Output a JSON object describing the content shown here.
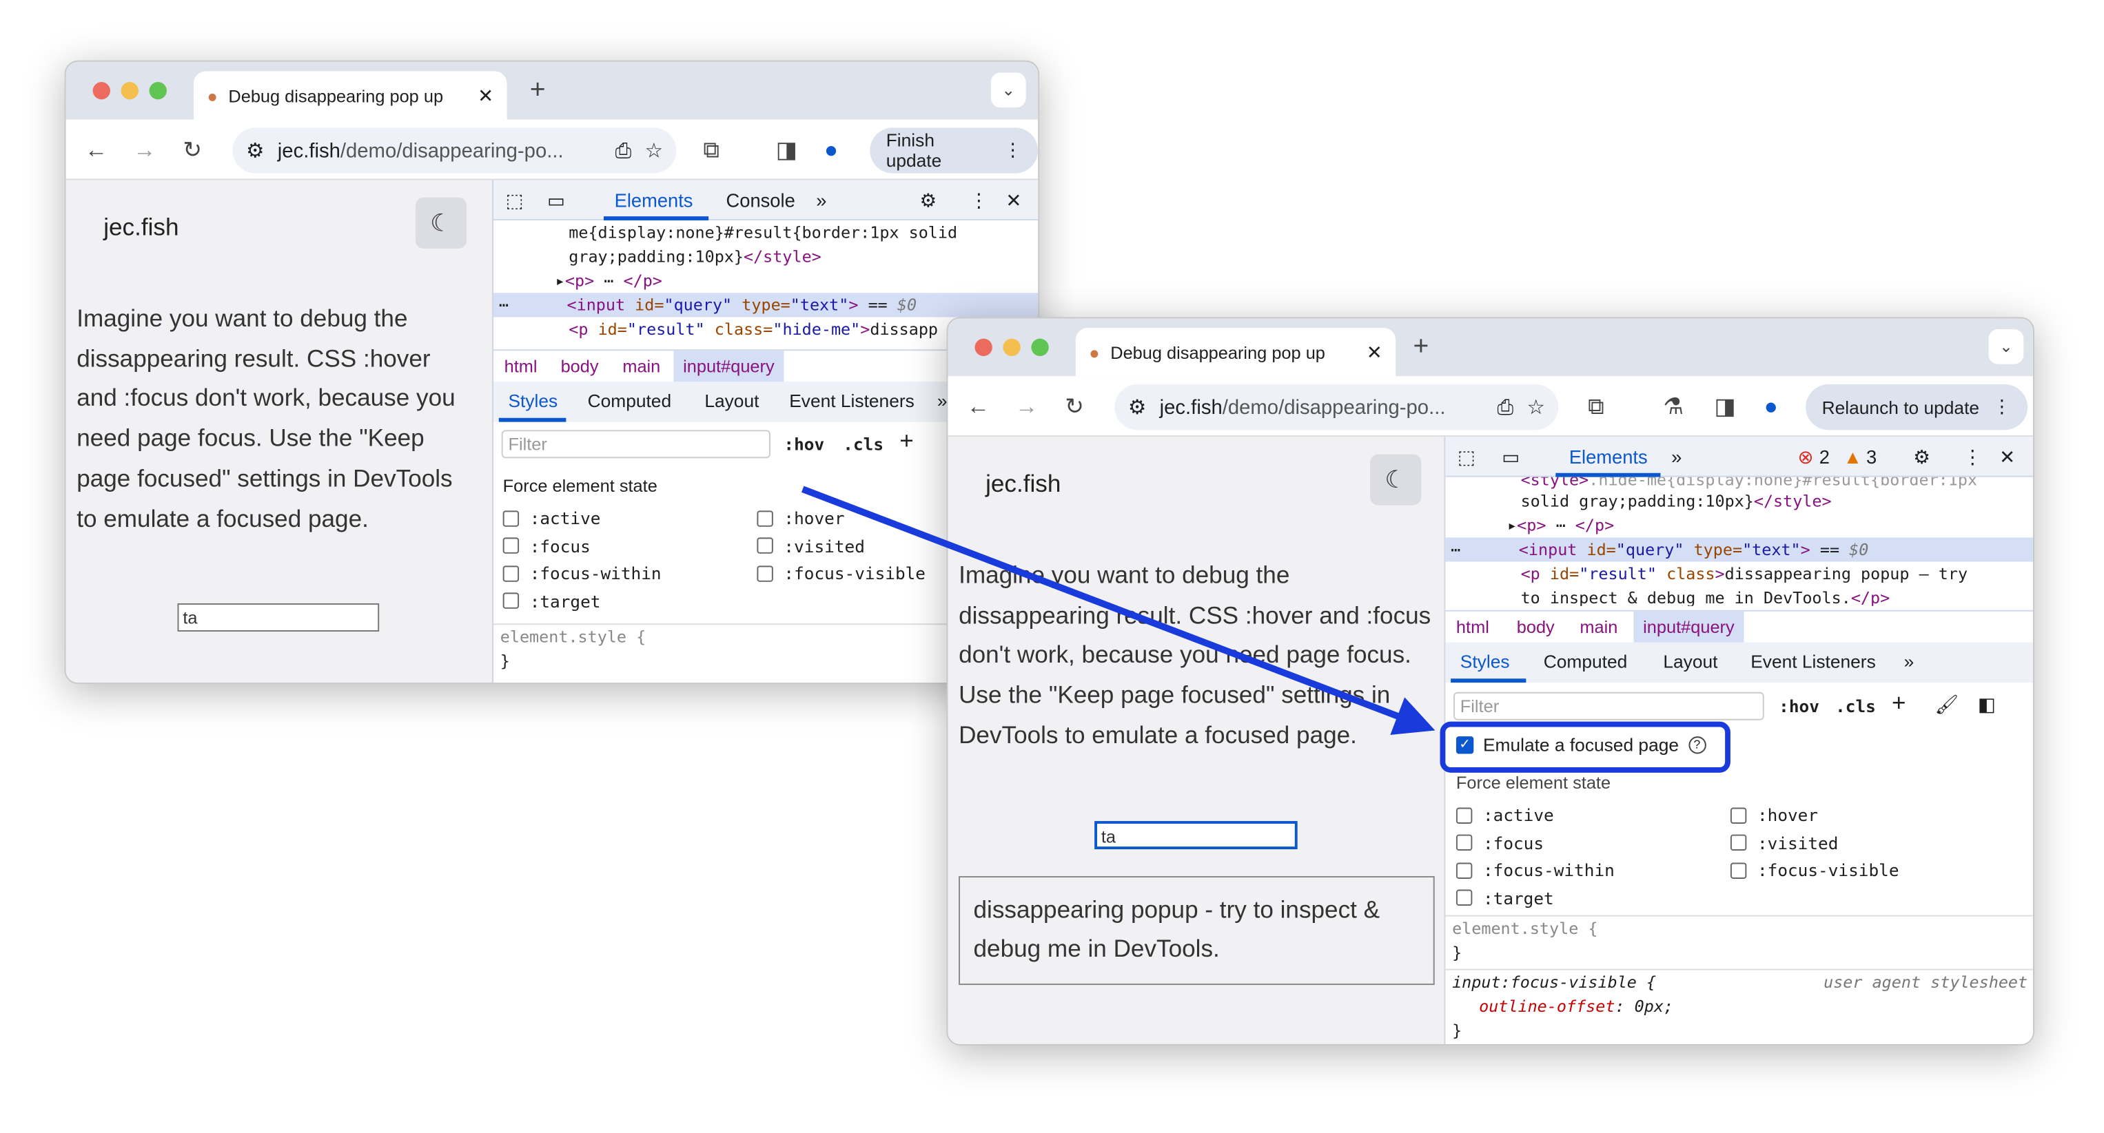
{
  "windows": [
    {
      "tab_title": "Debug disappearing pop up",
      "url_host": "jec.fish",
      "url_path": "/demo/disappearing-po...",
      "toolbar_button": "Finish update",
      "site_title": "jec.fish",
      "page_text": "Imagine you want to debug the dissappearing result. CSS :hover and :focus don't work, because you need page focus. Use the \"Keep page focused\" settings in DevTools to emulate a focused page.",
      "input_value": "ta",
      "devtools": {
        "tabs": [
          "Elements",
          "Console"
        ],
        "code": [
          "me{display:none}#result{border:1px solid",
          "gray;padding:10px}</style>"
        ],
        "breadcrumbs": [
          "html",
          "body",
          "main",
          "input#query"
        ],
        "subtabs": [
          "Styles",
          "Computed",
          "Layout",
          "Event Listeners"
        ],
        "filter_placeholder": "Filter",
        "hov": ":hov",
        "cls": ".cls",
        "force_state_title": "Force element state",
        "states_left": [
          ":active",
          ":focus",
          ":focus-within",
          ":target"
        ],
        "states_right": [
          ":hover",
          ":visited",
          ":focus-visible"
        ],
        "element_style": "element.style {",
        "close_brace": "}"
      }
    },
    {
      "tab_title": "Debug disappearing pop up",
      "url_host": "jec.fish",
      "url_path": "/demo/disappearing-po...",
      "toolbar_button": "Relaunch to update",
      "site_title": "jec.fish",
      "page_text": "Imagine you want to debug the dissappearing result. CSS :hover and :focus don't work, because you need page focus. Use the \"Keep page focused\" settings in DevTools to emulate a focused page.",
      "input_value": "ta",
      "popup_text": "dissappearing popup - try to inspect & debug me in DevTools.",
      "devtools": {
        "tabs": [
          "Elements"
        ],
        "errors": "2",
        "warnings": "3",
        "breadcrumbs": [
          "html",
          "body",
          "main",
          "input#query"
        ],
        "subtabs": [
          "Styles",
          "Computed",
          "Layout",
          "Event Listeners"
        ],
        "filter_placeholder": "Filter",
        "hov": ":hov",
        "cls": ".cls",
        "emulate_label": "Emulate a focused page",
        "emulate_checked": true,
        "force_state_title": "Force element state",
        "states_left": [
          ":active",
          ":focus",
          ":focus-within",
          ":target"
        ],
        "states_right": [
          ":hover",
          ":visited",
          ":focus-visible"
        ],
        "element_style": "element.style {",
        "close_brace": "}",
        "rule_selector": "input:focus-visible {",
        "rule_source": "user agent stylesheet",
        "rule_prop": "outline-offset",
        "rule_value": "0px;"
      }
    }
  ],
  "colors": {
    "annotation": "#1a3bdc",
    "accent": "#0b57d0"
  }
}
